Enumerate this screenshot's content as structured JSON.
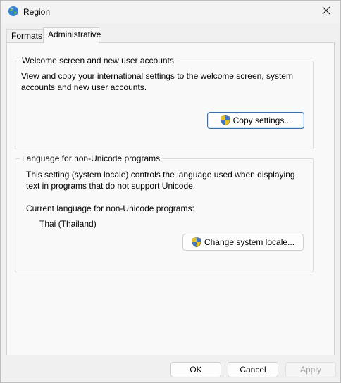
{
  "window": {
    "title": "Region",
    "icon": "globe-icon",
    "close_icon": "close-icon"
  },
  "tabs": [
    {
      "label": "Formats",
      "active": false
    },
    {
      "label": "Administrative",
      "active": true
    }
  ],
  "welcome_group": {
    "legend": "Welcome screen and new user accounts",
    "description_line1": "View and copy your international settings to the welcome screen, system",
    "description_line2": "accounts and new user accounts.",
    "copy_button": "Copy settings...",
    "button_icon": "uac-shield-icon"
  },
  "locale_group": {
    "legend": "Language for non-Unicode programs",
    "description_line1": "This setting (system locale) controls the language used when displaying",
    "description_line2": "text in programs that do not support Unicode.",
    "current_label": "Current language for non-Unicode programs:",
    "current_value": "Thai (Thailand)",
    "change_button": "Change system locale...",
    "button_icon": "uac-shield-icon"
  },
  "footer": {
    "ok": "OK",
    "cancel": "Cancel",
    "apply": "Apply",
    "apply_enabled": false
  },
  "colors": {
    "accent_focus": "#3b6ea5",
    "panel_bg": "#f9f9f9",
    "window_bg": "#f0f0f0",
    "disabled_text": "#a0a0a0"
  }
}
